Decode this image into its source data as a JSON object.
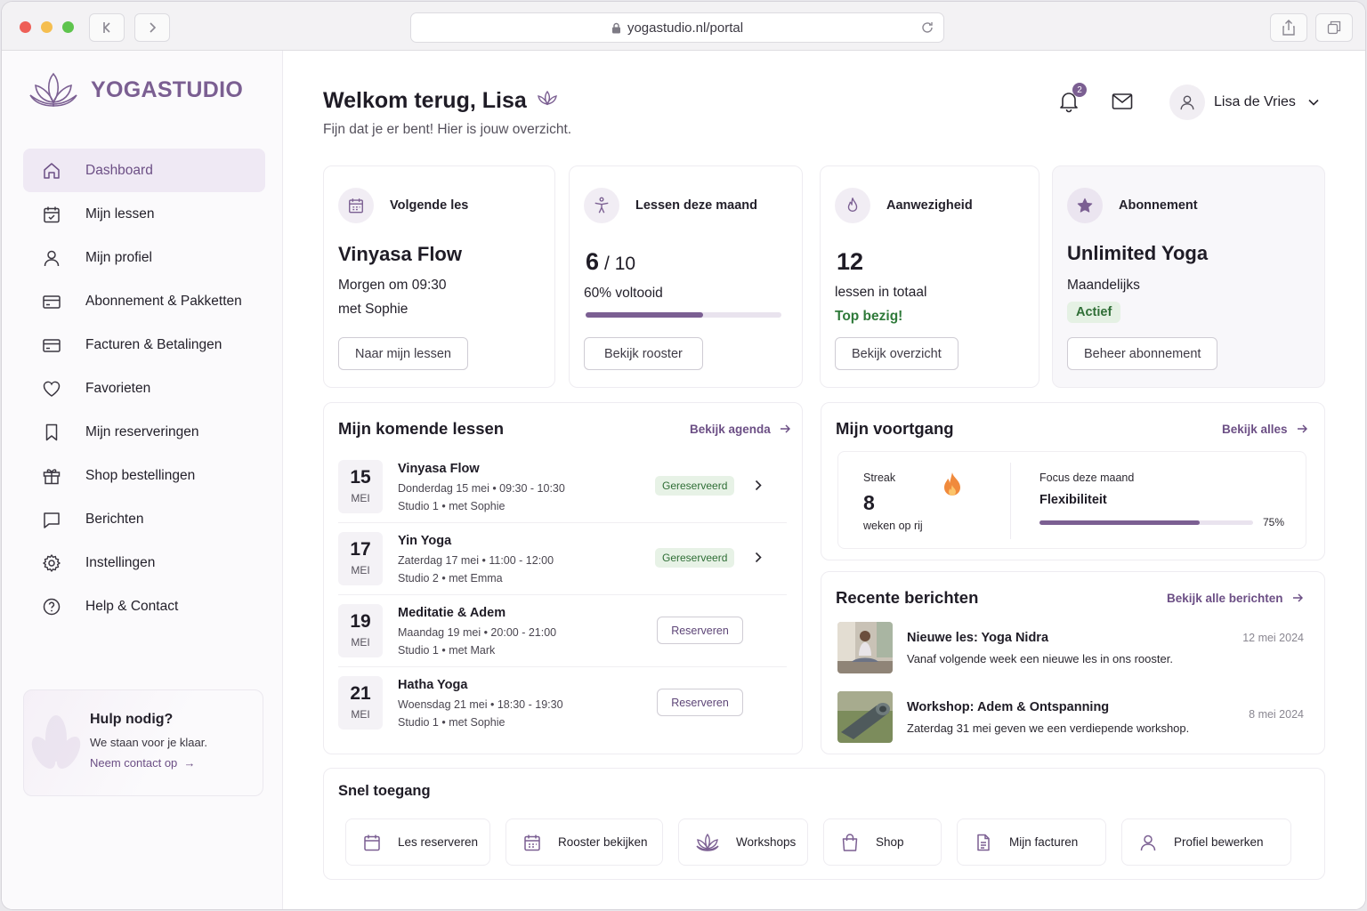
{
  "browser": {
    "url": "yogastudio.nl/portal"
  },
  "brand": {
    "name": "YOGASTUDIO",
    "accent": "#7b5f92"
  },
  "sidebar": {
    "items": [
      {
        "label": "Dashboard",
        "icon": "home-icon",
        "active": true
      },
      {
        "label": "Mijn lessen",
        "icon": "calendar-icon"
      },
      {
        "label": "Mijn profiel",
        "icon": "user-icon"
      },
      {
        "label": "Abonnement & Pakketten",
        "icon": "card-icon"
      },
      {
        "label": "Facturen & Betalingen",
        "icon": "card-icon"
      },
      {
        "label": "Favorieten",
        "icon": "heart-icon"
      },
      {
        "label": "Mijn reserveringen",
        "icon": "bookmark-icon"
      },
      {
        "label": "Shop bestellingen",
        "icon": "gift-icon"
      },
      {
        "label": "Berichten",
        "icon": "chat-icon"
      },
      {
        "label": "Instellingen",
        "icon": "gear-icon"
      },
      {
        "label": "Help & Contact",
        "icon": "help-icon"
      }
    ],
    "help": {
      "title": "Hulp nodig?",
      "subtitle": "We staan voor je klaar.",
      "link": "Neem contact op"
    }
  },
  "header": {
    "welcome": "Welkom terug, Lisa",
    "subtitle": "Fijn dat je er bent! Hier is jouw overzicht.",
    "notifications": "2",
    "user_name": "Lisa de Vries"
  },
  "stats": {
    "next": {
      "label": "Volgende les",
      "title": "Vinyasa Flow",
      "line1": "Morgen om 09:30",
      "line2": "met Sophie",
      "button": "Naar mijn lessen"
    },
    "month": {
      "label": "Lessen deze maand",
      "count": "6",
      "total": "/ 10",
      "progress_text": "60% voltooid",
      "progress": 0.6,
      "button": "Bekijk rooster"
    },
    "attendance": {
      "label": "Aanwezigheid",
      "count": "12",
      "line": "lessen in totaal",
      "note": "Top bezig!",
      "button": "Bekijk overzicht"
    },
    "subscription": {
      "label": "Abonnement",
      "title": "Unlimited Yoga",
      "line": "Maandelijks",
      "status": "Actief",
      "button": "Beheer abonnement"
    }
  },
  "upcoming": {
    "title": "Mijn komende lessen",
    "link": "Bekijk agenda",
    "lessons": [
      {
        "day": "15",
        "month": "MEI",
        "name": "Vinyasa Flow",
        "when": "Donderdag 15 mei • 09:30 - 10:30",
        "where": "Studio 1 • met Sophie",
        "status": "Gereserveerd"
      },
      {
        "day": "17",
        "month": "MEI",
        "name": "Yin Yoga",
        "when": "Zaterdag 17 mei • 11:00 - 12:00",
        "where": "Studio 2 • met Emma",
        "status": "Gereserveerd"
      },
      {
        "day": "19",
        "month": "MEI",
        "name": "Meditatie & Adem",
        "when": "Maandag 19 mei • 20:00 - 21:00",
        "where": "Studio 1 • met Mark",
        "action": "Reserveren"
      },
      {
        "day": "21",
        "month": "MEI",
        "name": "Hatha Yoga",
        "when": "Woensdag 21 mei • 18:30 - 19:30",
        "where": "Studio 1 • met Sophie",
        "action": "Reserveren"
      }
    ]
  },
  "progress": {
    "title": "Mijn voortgang",
    "link": "Bekijk alles",
    "streak_label": "Streak",
    "streak_value": "8",
    "streak_unit": "weken op rij",
    "focus_label": "Focus deze maand",
    "focus_value": "Flexibiliteit",
    "focus_pct": "75%",
    "focus_progress": 0.75
  },
  "messages": {
    "title": "Recente berichten",
    "link": "Bekijk alle berichten",
    "items": [
      {
        "title": "Nieuwe les: Yoga Nidra",
        "text": "Vanaf volgende week een nieuwe les in ons rooster.",
        "date": "12 mei 2024"
      },
      {
        "title": "Workshop: Adem & Ontspanning",
        "text": "Zaterdag 31 mei geven we een verdiepende workshop.",
        "date": "8 mei 2024"
      }
    ]
  },
  "quick": {
    "title": "Snel toegang",
    "items": [
      {
        "label": "Les reserveren",
        "icon": "calendar-icon"
      },
      {
        "label": "Rooster bekijken",
        "icon": "calendar-grid-icon"
      },
      {
        "label": "Workshops",
        "icon": "lotus-icon"
      },
      {
        "label": "Shop",
        "icon": "shopping-bag-icon"
      },
      {
        "label": "Mijn facturen",
        "icon": "document-icon"
      },
      {
        "label": "Profiel bewerken",
        "icon": "user-icon"
      }
    ]
  }
}
